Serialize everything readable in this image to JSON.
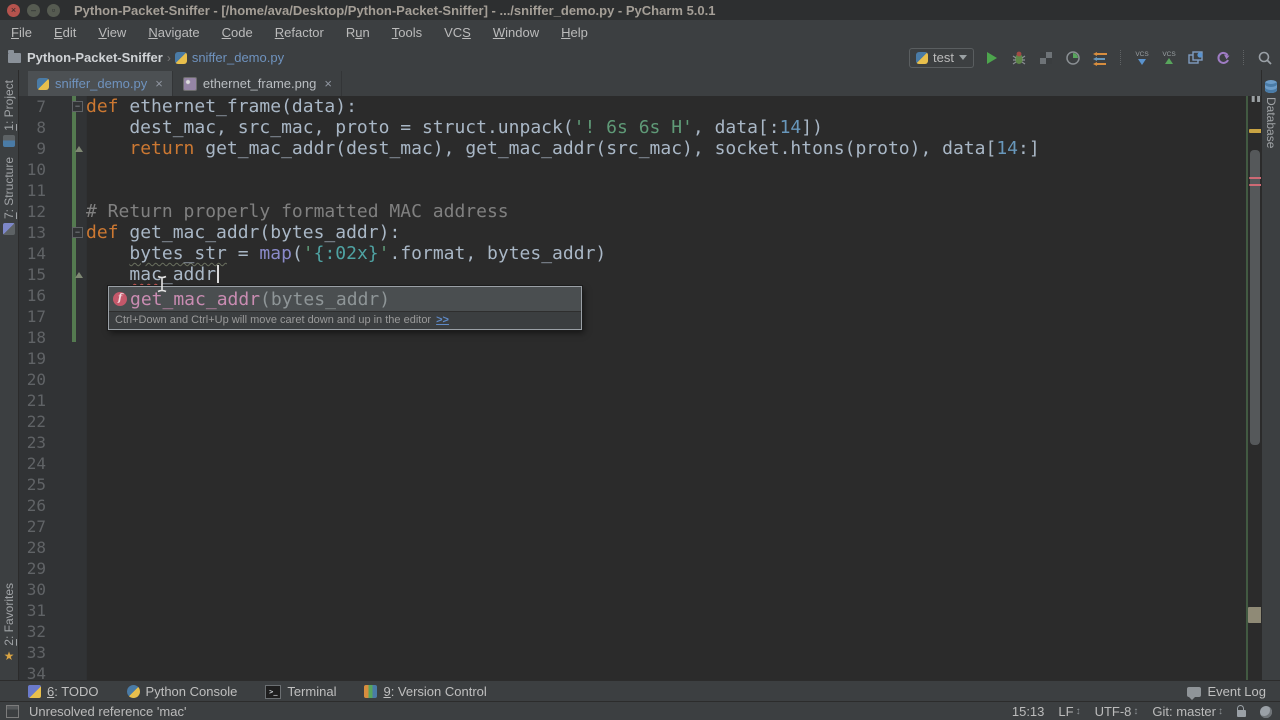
{
  "window": {
    "title": "Python-Packet-Sniffer - [/home/ava/Desktop/Python-Packet-Sniffer] - .../sniffer_demo.py - PyCharm 5.0.1"
  },
  "menubar": {
    "items": [
      {
        "label": "File",
        "u": 0
      },
      {
        "label": "Edit",
        "u": 0
      },
      {
        "label": "View",
        "u": 0
      },
      {
        "label": "Navigate",
        "u": 0
      },
      {
        "label": "Code",
        "u": 0
      },
      {
        "label": "Refactor",
        "u": 0
      },
      {
        "label": "Run",
        "u": 1
      },
      {
        "label": "Tools",
        "u": 0
      },
      {
        "label": "VCS",
        "u": 2
      },
      {
        "label": "Window",
        "u": 0
      },
      {
        "label": "Help",
        "u": 0
      }
    ]
  },
  "navbar": {
    "project": "Python-Packet-Sniffer",
    "separator": "›",
    "file": "sniffer_demo.py"
  },
  "toolbar": {
    "run_config": "test",
    "icons": [
      "python-icon",
      "run-icon",
      "debug-icon",
      "coverage-icon",
      "profile-icon",
      "concurrency-icon",
      "vcs-update-icon",
      "vcs-commit-icon",
      "compare-icon",
      "rollback-icon",
      "search-icon"
    ]
  },
  "tabs": [
    {
      "label": "sniffer_demo.py",
      "icon": "python-file-icon",
      "active": true,
      "modified": true,
      "close": "×"
    },
    {
      "label": "ethernet_frame.png",
      "icon": "image-file-icon",
      "active": false,
      "modified": false,
      "close": "×"
    }
  ],
  "editor": {
    "caret_line": 15,
    "lines": [
      {
        "n": 7,
        "fold": "minus",
        "tokens": [
          [
            "kw",
            "def"
          ],
          [
            "pl",
            " ethernet_frame(data):"
          ]
        ]
      },
      {
        "n": 8,
        "tokens": [
          [
            "pl",
            "    dest_mac, src_mac, proto = struct.unpack("
          ],
          [
            "str",
            "'! 6s 6s H'"
          ],
          [
            "pl",
            ", data[:"
          ],
          [
            "num",
            "14"
          ],
          [
            "pl",
            "])"
          ]
        ]
      },
      {
        "n": 9,
        "fold": "arrow",
        "tokens": [
          [
            "pl",
            "    "
          ],
          [
            "kw",
            "return"
          ],
          [
            "pl",
            " get_mac_addr(dest_mac), get_mac_addr(src_mac), socket.htons(proto), data["
          ],
          [
            "num",
            "14"
          ],
          [
            "pl",
            ":]"
          ]
        ]
      },
      {
        "n": 10,
        "tokens": []
      },
      {
        "n": 11,
        "tokens": []
      },
      {
        "n": 12,
        "tokens": [
          [
            "cm",
            "# Return properly formatted MAC address"
          ]
        ]
      },
      {
        "n": 13,
        "fold": "minus",
        "tokens": [
          [
            "kw",
            "def"
          ],
          [
            "pl",
            " get_mac_addr(bytes_addr):"
          ]
        ]
      },
      {
        "n": 14,
        "tokens": [
          [
            "pl",
            "    "
          ],
          [
            "us",
            "bytes_str"
          ],
          [
            "pl",
            " = "
          ],
          [
            "bi",
            "map"
          ],
          [
            "pl",
            "("
          ],
          [
            "str",
            "'"
          ],
          [
            "fmt",
            "{:02x}"
          ],
          [
            "str",
            "'"
          ],
          [
            "pl",
            ".format, bytes_addr)"
          ]
        ]
      },
      {
        "n": 15,
        "fold": "arrow",
        "tokens": [
          [
            "pl",
            "    "
          ],
          [
            "er",
            "mac"
          ],
          [
            "pl",
            "_addr"
          ]
        ]
      },
      {
        "n": 16,
        "tokens": []
      },
      {
        "n": 17,
        "tokens": []
      },
      {
        "n": 18,
        "tokens": []
      },
      {
        "n": 19,
        "tokens": []
      },
      {
        "n": 20,
        "tokens": []
      },
      {
        "n": 21,
        "tokens": []
      },
      {
        "n": 22,
        "tokens": []
      },
      {
        "n": 23,
        "tokens": []
      },
      {
        "n": 24,
        "tokens": []
      },
      {
        "n": 25,
        "tokens": []
      },
      {
        "n": 26,
        "tokens": []
      },
      {
        "n": 27,
        "tokens": []
      },
      {
        "n": 28,
        "tokens": []
      },
      {
        "n": 29,
        "tokens": []
      },
      {
        "n": 30,
        "tokens": []
      },
      {
        "n": 31,
        "tokens": []
      },
      {
        "n": 32,
        "tokens": []
      },
      {
        "n": 33,
        "tokens": []
      },
      {
        "n": 34,
        "tokens": []
      }
    ]
  },
  "popup": {
    "item_name": "get_mac_addr",
    "item_params": "(bytes_addr)",
    "hint": "Ctrl+Down and Ctrl+Up will move caret down and up in the editor",
    "hint_link": ">>"
  },
  "tool_windows": {
    "left": [
      {
        "label": "1: Project",
        "icon": "project-icon",
        "u": 0
      },
      {
        "label": "7: Structure",
        "icon": "structure-icon",
        "u": 0
      },
      {
        "label": "2: Favorites",
        "icon": "favorites-icon",
        "u": 0
      }
    ],
    "right": [
      {
        "label": "Database",
        "icon": "database-icon"
      }
    ],
    "bottom": [
      {
        "label": "6: TODO",
        "icon": "todo-icon",
        "u": 0
      },
      {
        "label": "Python Console",
        "icon": "python-console-icon",
        "u": -1
      },
      {
        "label": "Terminal",
        "icon": "terminal-icon",
        "u": -1
      },
      {
        "label": "9: Version Control",
        "icon": "version-control-icon",
        "u": 0
      }
    ],
    "bottom_right": [
      {
        "label": "Event Log",
        "icon": "event-log-icon"
      }
    ]
  },
  "statusbar": {
    "message": "Unresolved reference 'mac'",
    "items": [
      {
        "text": "15:13",
        "arrows": false
      },
      {
        "text": "LF",
        "arrows": true
      },
      {
        "text": "UTF-8",
        "arrows": true
      },
      {
        "text": "Git: master",
        "arrows": true
      }
    ]
  },
  "colors": {
    "keyword": "#cc7832",
    "string": "#5f9a77",
    "format_spec": "#4fa3a3",
    "number": "#6897bb",
    "comment": "#808080",
    "builtin": "#8a8ac9",
    "plain": "#a9b7c6",
    "error": "#cf5b56",
    "unused": "#6a705f",
    "vcs_added": "#547a50",
    "run_green": "#4da54d",
    "caret": "#dcdcdc",
    "modified_file": "#6f93bf"
  }
}
